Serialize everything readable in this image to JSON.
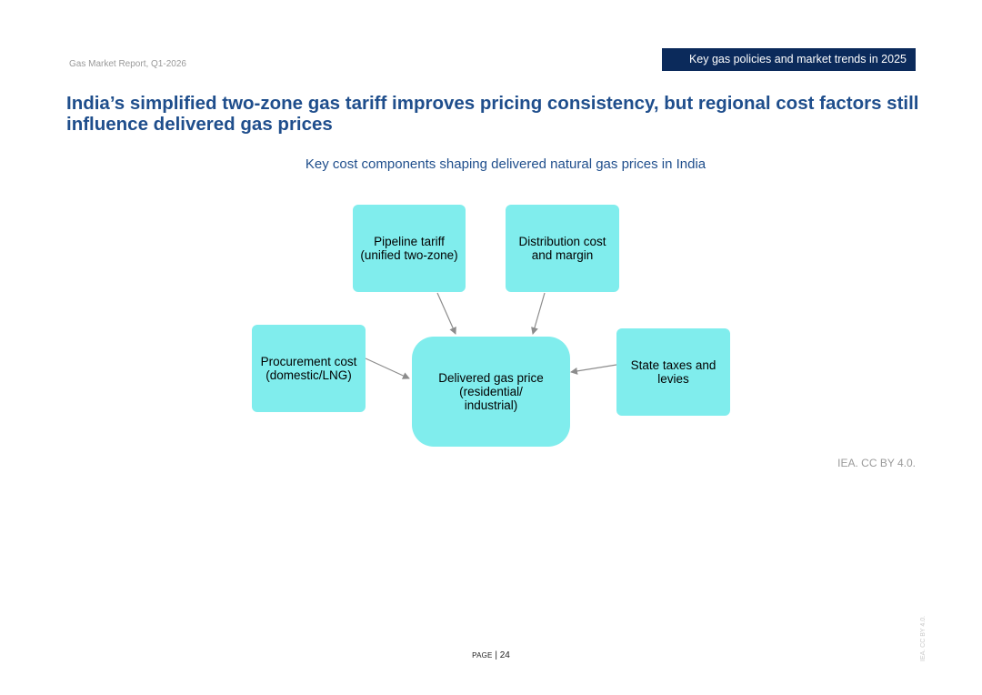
{
  "header": {
    "report_name": "Gas Market Report, Q1-2026",
    "section_tag": "Key gas policies and market trends in 2025"
  },
  "page_title": "India’s simplified two-zone gas tariff improves pricing consistency, but regional cost factors still influence delivered gas prices",
  "figure": {
    "title": "Key cost components shaping delivered natural gas prices in India",
    "nodes": {
      "pipeline": "Pipeline tariff\n(unified two-zone)",
      "distribution": "Distribution cost\nand margin",
      "procurement": "Procurement cost\n(domestic/LNG)",
      "delivered": "Delivered gas price\n(residential/\nindustrial)",
      "taxes": "State taxes and\nlevies"
    },
    "edges": [
      {
        "from": "pipeline",
        "to": "delivered"
      },
      {
        "from": "distribution",
        "to": "delivered"
      },
      {
        "from": "procurement",
        "to": "delivered"
      },
      {
        "from": "taxes",
        "to": "delivered"
      }
    ],
    "node_color": "#80eded",
    "credit": "IEA. CC BY 4.0."
  },
  "footer": {
    "page_word": "Page",
    "separator": "|",
    "page_number": "24",
    "side_credit": "IEA. CC BY 4.0."
  },
  "colors": {
    "title": "#1f4e8c",
    "tag_background": "#0b2a5b",
    "arrow": "#8c8c8c"
  }
}
